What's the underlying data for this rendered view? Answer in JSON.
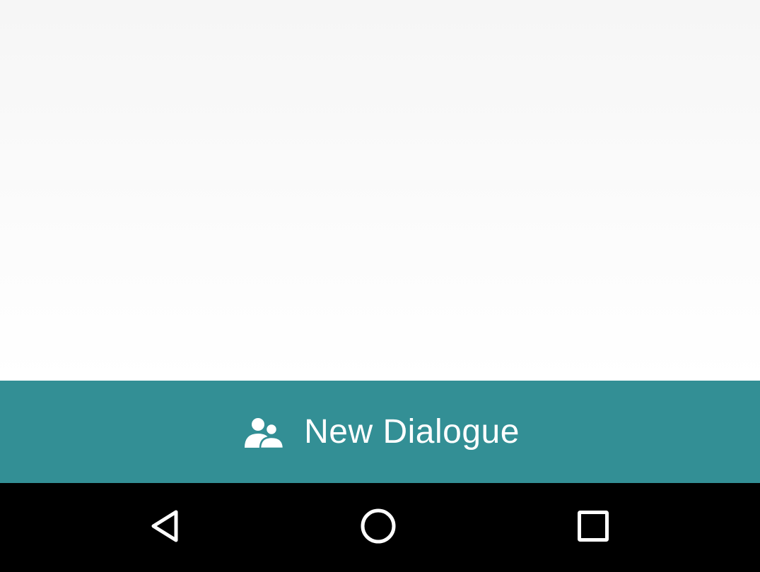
{
  "main": {
    "new_dialogue_label": "New Dialogue",
    "new_dialogue_icon": "group-icon",
    "accent_color": "#338f95"
  },
  "navigation_bar": {
    "background": "#000000",
    "buttons": [
      {
        "name": "back",
        "icon": "back-triangle-icon"
      },
      {
        "name": "home",
        "icon": "home-circle-icon"
      },
      {
        "name": "recents",
        "icon": "recents-square-icon"
      }
    ]
  }
}
